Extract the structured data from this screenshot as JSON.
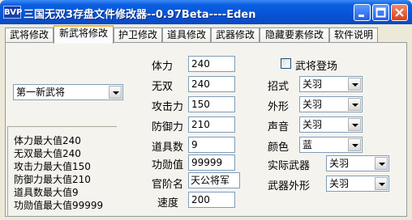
{
  "window": {
    "title": "三国无双3存盘文件修改器--0.97Beta----Eden",
    "icon_text": "BVP"
  },
  "tabs": [
    {
      "label": "武将修改"
    },
    {
      "label": "新武将修改"
    },
    {
      "label": "护卫修改"
    },
    {
      "label": "道具修改"
    },
    {
      "label": "武器修改"
    },
    {
      "label": "隐藏要素修改"
    },
    {
      "label": "软件说明"
    }
  ],
  "general_select": {
    "value": "第一新武将"
  },
  "stats": {
    "hp": {
      "label": "体力",
      "value": "240"
    },
    "musou": {
      "label": "无双",
      "value": "240"
    },
    "attack": {
      "label": "攻击力",
      "value": "150"
    },
    "defense": {
      "label": "防御力",
      "value": "210"
    },
    "items": {
      "label": "道具数",
      "value": "9"
    },
    "merit": {
      "label": "功勋值",
      "value": "99999"
    },
    "rank": {
      "label": "官阶名",
      "value": "天公将军"
    },
    "speed": {
      "label": "速度",
      "value": "200"
    }
  },
  "max_info": [
    "体力最大值240",
    "无双最大值240",
    "攻击力最大值150",
    "防御力最大值210",
    "道具数最大值9",
    "功勋值最大值99999"
  ],
  "checkbox": {
    "label": "武将登场"
  },
  "right_fields": {
    "moveset": {
      "label": "招式",
      "value": "关羽"
    },
    "appearance": {
      "label": "外形",
      "value": "关羽"
    },
    "voice": {
      "label": "声音",
      "value": "关羽"
    },
    "color": {
      "label": "颜色",
      "value": "蓝"
    },
    "weapon": {
      "label": "实际武器",
      "value": "关羽"
    },
    "weapon_look": {
      "label": "武器外形",
      "value": "关羽"
    }
  }
}
